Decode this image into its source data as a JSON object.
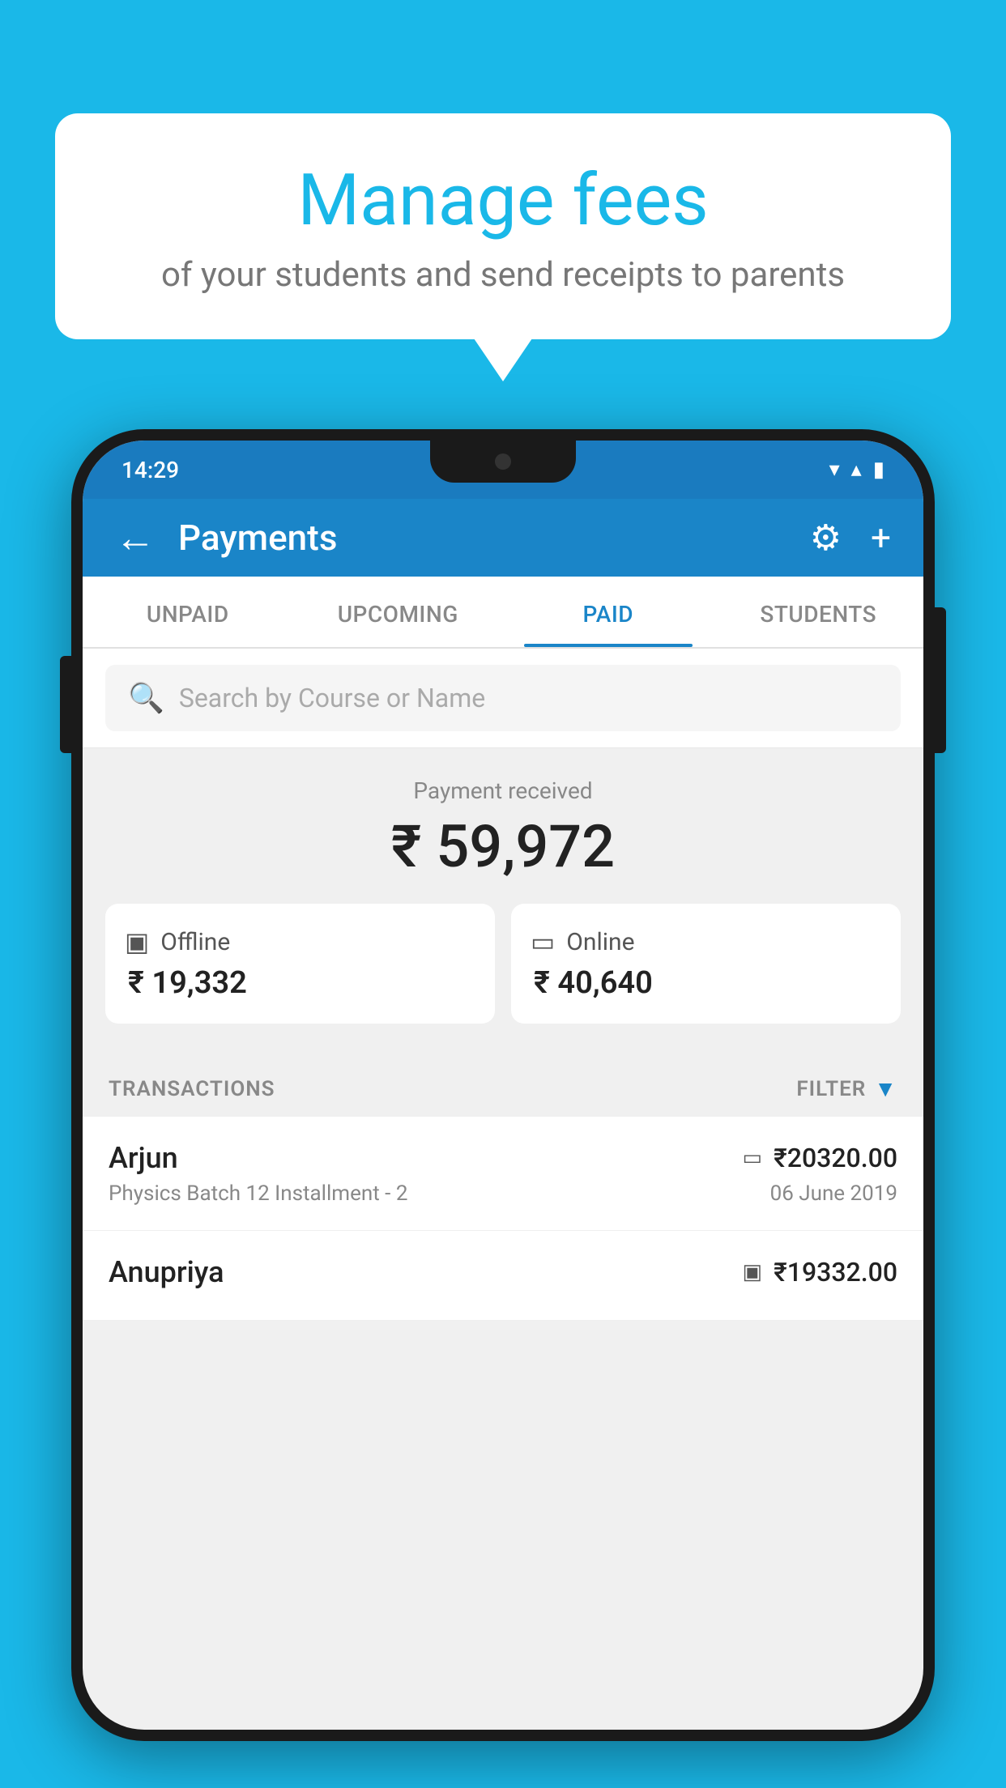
{
  "background_color": "#1ab8e8",
  "bubble": {
    "title": "Manage fees",
    "subtitle": "of your students and send receipts to parents"
  },
  "status_bar": {
    "time": "14:29",
    "wifi_icon": "▼",
    "signal_icon": "▲",
    "battery_icon": "▮"
  },
  "header": {
    "title": "Payments",
    "back_label": "←",
    "settings_label": "⚙",
    "add_label": "+"
  },
  "tabs": [
    {
      "label": "UNPAID",
      "active": false
    },
    {
      "label": "UPCOMING",
      "active": false
    },
    {
      "label": "PAID",
      "active": true
    },
    {
      "label": "STUDENTS",
      "active": false
    }
  ],
  "search": {
    "placeholder": "Search by Course or Name"
  },
  "payment_summary": {
    "received_label": "Payment received",
    "total_amount": "₹ 59,972",
    "offline_label": "Offline",
    "offline_amount": "₹ 19,332",
    "online_label": "Online",
    "online_amount": "₹ 40,640"
  },
  "transactions_section": {
    "header_label": "TRANSACTIONS",
    "filter_label": "FILTER",
    "filter_icon": "▼"
  },
  "transactions": [
    {
      "name": "Arjun",
      "course": "Physics Batch 12 Installment - 2",
      "amount": "₹20320.00",
      "date": "06 June 2019",
      "payment_type": "online",
      "type_icon": "▭"
    },
    {
      "name": "Anupriya",
      "course": "",
      "amount": "₹19332.00",
      "date": "",
      "payment_type": "offline",
      "type_icon": "▣"
    }
  ]
}
